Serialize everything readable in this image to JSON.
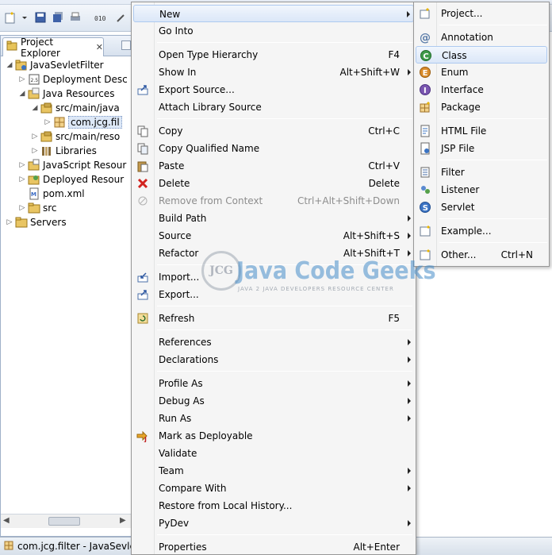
{
  "explorer": {
    "tab_label": "Project Explorer",
    "tree": [
      {
        "label": "JavaSevletFilter",
        "level": 0,
        "toggle": "open",
        "icon": "project-icon"
      },
      {
        "label": "Deployment Desc",
        "level": 1,
        "toggle": "closed",
        "icon": "deployment-descriptor-icon"
      },
      {
        "label": "Java Resources",
        "level": 1,
        "toggle": "open",
        "icon": "java-resources-icon"
      },
      {
        "label": "src/main/java",
        "level": 2,
        "toggle": "open",
        "icon": "source-folder-icon"
      },
      {
        "label": "com.jcg.fil",
        "level": 3,
        "toggle": "closed",
        "icon": "package-icon",
        "selected": true
      },
      {
        "label": "src/main/reso",
        "level": 2,
        "toggle": "closed",
        "icon": "source-folder-icon"
      },
      {
        "label": "Libraries",
        "level": 2,
        "toggle": "closed",
        "icon": "libraries-icon"
      },
      {
        "label": "JavaScript Resour",
        "level": 1,
        "toggle": "closed",
        "icon": "javascript-resources-icon"
      },
      {
        "label": "Deployed Resour",
        "level": 1,
        "toggle": "closed",
        "icon": "deployed-resources-icon"
      },
      {
        "label": "pom.xml",
        "level": 1,
        "toggle": "none",
        "icon": "xml-file-icon"
      },
      {
        "label": "src",
        "level": 1,
        "toggle": "closed",
        "icon": "folder-icon"
      },
      {
        "label": "Servers",
        "level": 0,
        "toggle": "closed",
        "icon": "folder-icon"
      }
    ]
  },
  "statusbar": {
    "text": "com.jcg.filter - JavaSevletFi"
  },
  "context_menu": [
    {
      "label": "New",
      "shortcut": "",
      "submenu": true,
      "highlighted": true,
      "icon": ""
    },
    {
      "label": "Go Into",
      "shortcut": ""
    },
    {
      "sep": true
    },
    {
      "label": "Open Type Hierarchy",
      "shortcut": "F4"
    },
    {
      "label": "Show In",
      "shortcut": "Alt+Shift+W",
      "submenu": true
    },
    {
      "label": "Export Source...",
      "shortcut": "",
      "icon": "export-source-icon"
    },
    {
      "label": "Attach Library Source",
      "shortcut": ""
    },
    {
      "sep": true
    },
    {
      "label": "Copy",
      "shortcut": "Ctrl+C",
      "icon": "copy-icon"
    },
    {
      "label": "Copy Qualified Name",
      "shortcut": "",
      "icon": "copy-qualified-icon"
    },
    {
      "label": "Paste",
      "shortcut": "Ctrl+V",
      "icon": "paste-icon"
    },
    {
      "label": "Delete",
      "shortcut": "Delete",
      "icon": "delete-icon"
    },
    {
      "label": "Remove from Context",
      "shortcut": "Ctrl+Alt+Shift+Down",
      "disabled": true,
      "icon": "remove-context-icon"
    },
    {
      "label": "Build Path",
      "shortcut": "",
      "submenu": true
    },
    {
      "label": "Source",
      "shortcut": "Alt+Shift+S",
      "submenu": true
    },
    {
      "label": "Refactor",
      "shortcut": "Alt+Shift+T",
      "submenu": true
    },
    {
      "sep": true
    },
    {
      "label": "Import...",
      "shortcut": "",
      "icon": "import-icon"
    },
    {
      "label": "Export...",
      "shortcut": "",
      "icon": "export-icon"
    },
    {
      "sep": true
    },
    {
      "label": "Refresh",
      "shortcut": "F5",
      "icon": "refresh-icon"
    },
    {
      "sep": true
    },
    {
      "label": "References",
      "shortcut": "",
      "submenu": true
    },
    {
      "label": "Declarations",
      "shortcut": "",
      "submenu": true
    },
    {
      "sep": true
    },
    {
      "label": "Profile As",
      "shortcut": "",
      "submenu": true
    },
    {
      "label": "Debug As",
      "shortcut": "",
      "submenu": true
    },
    {
      "label": "Run As",
      "shortcut": "",
      "submenu": true
    },
    {
      "label": "Mark as Deployable",
      "shortcut": "",
      "icon": "deployable-icon"
    },
    {
      "label": "Validate",
      "shortcut": ""
    },
    {
      "label": "Team",
      "shortcut": "",
      "submenu": true
    },
    {
      "label": "Compare With",
      "shortcut": "",
      "submenu": true
    },
    {
      "label": "Restore from Local History...",
      "shortcut": ""
    },
    {
      "label": "PyDev",
      "shortcut": "",
      "submenu": true
    },
    {
      "sep": true
    },
    {
      "label": "Properties",
      "shortcut": "Alt+Enter"
    }
  ],
  "new_submenu": [
    {
      "label": "Project...",
      "shortcut": "",
      "icon": "new-project-icon"
    },
    {
      "sep": true
    },
    {
      "label": "Annotation",
      "shortcut": "",
      "icon": "annotation-icon"
    },
    {
      "label": "Class",
      "shortcut": "",
      "icon": "class-icon",
      "highlighted": true
    },
    {
      "label": "Enum",
      "shortcut": "",
      "icon": "enum-icon"
    },
    {
      "label": "Interface",
      "shortcut": "",
      "icon": "interface-icon"
    },
    {
      "label": "Package",
      "shortcut": "",
      "icon": "new-package-icon"
    },
    {
      "sep": true
    },
    {
      "label": "HTML File",
      "shortcut": "",
      "icon": "html-file-icon"
    },
    {
      "label": "JSP File",
      "shortcut": "",
      "icon": "jsp-file-icon"
    },
    {
      "sep": true
    },
    {
      "label": "Filter",
      "shortcut": "",
      "icon": "filter-icon"
    },
    {
      "label": "Listener",
      "shortcut": "",
      "icon": "listener-icon"
    },
    {
      "label": "Servlet",
      "shortcut": "",
      "icon": "servlet-icon"
    },
    {
      "sep": true
    },
    {
      "label": "Example...",
      "shortcut": "",
      "icon": "example-icon"
    },
    {
      "sep": true
    },
    {
      "label": "Other...",
      "shortcut": "Ctrl+N",
      "icon": "other-icon"
    }
  ],
  "watermark": {
    "logo_text": "JCG",
    "title": "Java Code Geeks",
    "subtitle": "JAVA 2 JAVA DEVELOPERS RESOURCE CENTER"
  }
}
